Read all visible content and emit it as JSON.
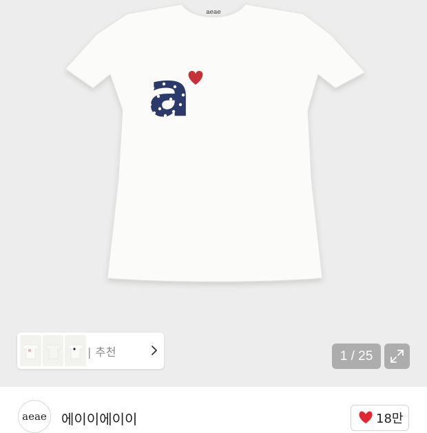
{
  "product": {
    "shirt_tag_text": "aeae",
    "shirt_print_text": "a",
    "image_counter": {
      "current": 1,
      "total": 25,
      "text": "1 / 25"
    },
    "expand_icon": "expand-arrows-icon"
  },
  "recommend": {
    "label": "| 추천",
    "arrow_icon": "chevron-right-icon"
  },
  "store": {
    "logo_text": "aeae",
    "name": "에이이에이이"
  },
  "like": {
    "icon": "heart-icon",
    "count": "18만",
    "color": "#e3262f"
  },
  "colors": {
    "background": "#ededed",
    "print_navy": "#2c3a6b",
    "heart_red": "#c8303a"
  }
}
